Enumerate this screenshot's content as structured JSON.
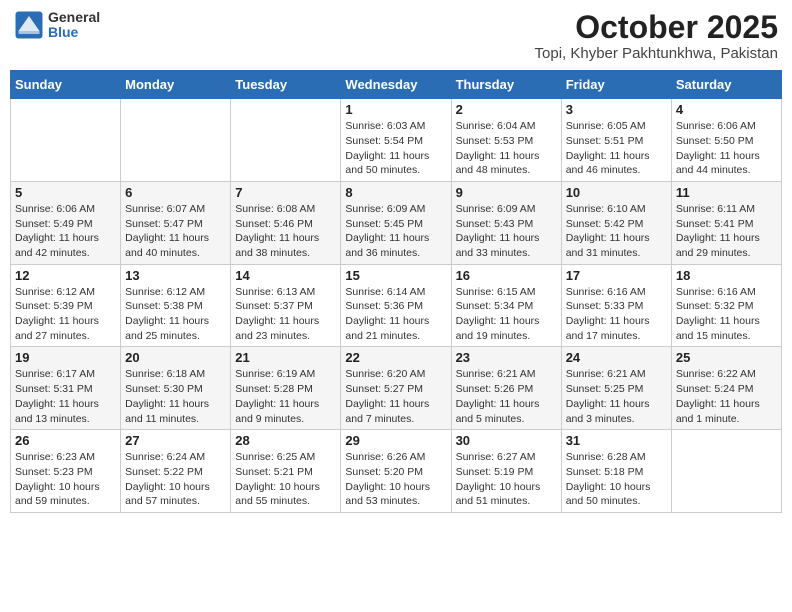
{
  "header": {
    "logo_general": "General",
    "logo_blue": "Blue",
    "month_title": "October 2025",
    "location": "Topi, Khyber Pakhtunkhwa, Pakistan"
  },
  "days_of_week": [
    "Sunday",
    "Monday",
    "Tuesday",
    "Wednesday",
    "Thursday",
    "Friday",
    "Saturday"
  ],
  "weeks": [
    [
      {
        "day": "",
        "info": ""
      },
      {
        "day": "",
        "info": ""
      },
      {
        "day": "",
        "info": ""
      },
      {
        "day": "1",
        "info": "Sunrise: 6:03 AM\nSunset: 5:54 PM\nDaylight: 11 hours\nand 50 minutes."
      },
      {
        "day": "2",
        "info": "Sunrise: 6:04 AM\nSunset: 5:53 PM\nDaylight: 11 hours\nand 48 minutes."
      },
      {
        "day": "3",
        "info": "Sunrise: 6:05 AM\nSunset: 5:51 PM\nDaylight: 11 hours\nand 46 minutes."
      },
      {
        "day": "4",
        "info": "Sunrise: 6:06 AM\nSunset: 5:50 PM\nDaylight: 11 hours\nand 44 minutes."
      }
    ],
    [
      {
        "day": "5",
        "info": "Sunrise: 6:06 AM\nSunset: 5:49 PM\nDaylight: 11 hours\nand 42 minutes."
      },
      {
        "day": "6",
        "info": "Sunrise: 6:07 AM\nSunset: 5:47 PM\nDaylight: 11 hours\nand 40 minutes."
      },
      {
        "day": "7",
        "info": "Sunrise: 6:08 AM\nSunset: 5:46 PM\nDaylight: 11 hours\nand 38 minutes."
      },
      {
        "day": "8",
        "info": "Sunrise: 6:09 AM\nSunset: 5:45 PM\nDaylight: 11 hours\nand 36 minutes."
      },
      {
        "day": "9",
        "info": "Sunrise: 6:09 AM\nSunset: 5:43 PM\nDaylight: 11 hours\nand 33 minutes."
      },
      {
        "day": "10",
        "info": "Sunrise: 6:10 AM\nSunset: 5:42 PM\nDaylight: 11 hours\nand 31 minutes."
      },
      {
        "day": "11",
        "info": "Sunrise: 6:11 AM\nSunset: 5:41 PM\nDaylight: 11 hours\nand 29 minutes."
      }
    ],
    [
      {
        "day": "12",
        "info": "Sunrise: 6:12 AM\nSunset: 5:39 PM\nDaylight: 11 hours\nand 27 minutes."
      },
      {
        "day": "13",
        "info": "Sunrise: 6:12 AM\nSunset: 5:38 PM\nDaylight: 11 hours\nand 25 minutes."
      },
      {
        "day": "14",
        "info": "Sunrise: 6:13 AM\nSunset: 5:37 PM\nDaylight: 11 hours\nand 23 minutes."
      },
      {
        "day": "15",
        "info": "Sunrise: 6:14 AM\nSunset: 5:36 PM\nDaylight: 11 hours\nand 21 minutes."
      },
      {
        "day": "16",
        "info": "Sunrise: 6:15 AM\nSunset: 5:34 PM\nDaylight: 11 hours\nand 19 minutes."
      },
      {
        "day": "17",
        "info": "Sunrise: 6:16 AM\nSunset: 5:33 PM\nDaylight: 11 hours\nand 17 minutes."
      },
      {
        "day": "18",
        "info": "Sunrise: 6:16 AM\nSunset: 5:32 PM\nDaylight: 11 hours\nand 15 minutes."
      }
    ],
    [
      {
        "day": "19",
        "info": "Sunrise: 6:17 AM\nSunset: 5:31 PM\nDaylight: 11 hours\nand 13 minutes."
      },
      {
        "day": "20",
        "info": "Sunrise: 6:18 AM\nSunset: 5:30 PM\nDaylight: 11 hours\nand 11 minutes."
      },
      {
        "day": "21",
        "info": "Sunrise: 6:19 AM\nSunset: 5:28 PM\nDaylight: 11 hours\nand 9 minutes."
      },
      {
        "day": "22",
        "info": "Sunrise: 6:20 AM\nSunset: 5:27 PM\nDaylight: 11 hours\nand 7 minutes."
      },
      {
        "day": "23",
        "info": "Sunrise: 6:21 AM\nSunset: 5:26 PM\nDaylight: 11 hours\nand 5 minutes."
      },
      {
        "day": "24",
        "info": "Sunrise: 6:21 AM\nSunset: 5:25 PM\nDaylight: 11 hours\nand 3 minutes."
      },
      {
        "day": "25",
        "info": "Sunrise: 6:22 AM\nSunset: 5:24 PM\nDaylight: 11 hours\nand 1 minute."
      }
    ],
    [
      {
        "day": "26",
        "info": "Sunrise: 6:23 AM\nSunset: 5:23 PM\nDaylight: 10 hours\nand 59 minutes."
      },
      {
        "day": "27",
        "info": "Sunrise: 6:24 AM\nSunset: 5:22 PM\nDaylight: 10 hours\nand 57 minutes."
      },
      {
        "day": "28",
        "info": "Sunrise: 6:25 AM\nSunset: 5:21 PM\nDaylight: 10 hours\nand 55 minutes."
      },
      {
        "day": "29",
        "info": "Sunrise: 6:26 AM\nSunset: 5:20 PM\nDaylight: 10 hours\nand 53 minutes."
      },
      {
        "day": "30",
        "info": "Sunrise: 6:27 AM\nSunset: 5:19 PM\nDaylight: 10 hours\nand 51 minutes."
      },
      {
        "day": "31",
        "info": "Sunrise: 6:28 AM\nSunset: 5:18 PM\nDaylight: 10 hours\nand 50 minutes."
      },
      {
        "day": "",
        "info": ""
      }
    ]
  ]
}
